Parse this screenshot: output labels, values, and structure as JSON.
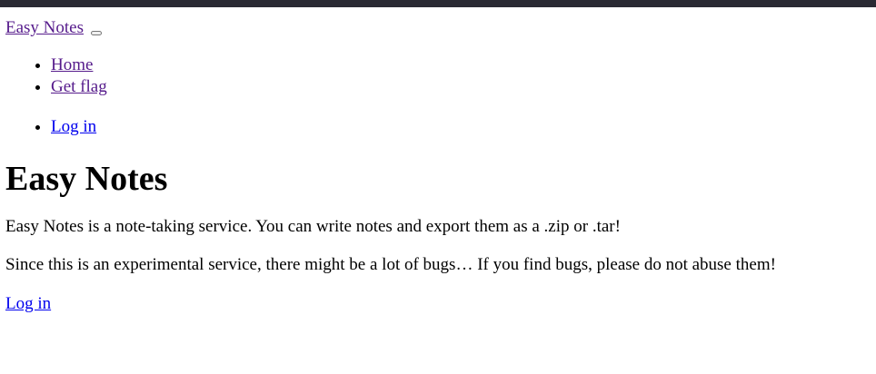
{
  "navbar": {
    "brand": "Easy Notes",
    "items": [
      {
        "label": "Home"
      },
      {
        "label": "Get flag"
      }
    ],
    "auth_items": [
      {
        "label": "Log in"
      }
    ]
  },
  "main": {
    "title": "Easy Notes",
    "intro": "Easy Notes is a note-taking service. You can write notes and export them as a .zip or .tar!",
    "warning": "Since this is an experimental service, there might be a lot of bugs… If you find bugs, please do not abuse them!",
    "login_link": "Log in"
  },
  "colors": {
    "top_bar": "#2a2a33",
    "visited_link": "#551a8b",
    "link": "#0000ee"
  }
}
